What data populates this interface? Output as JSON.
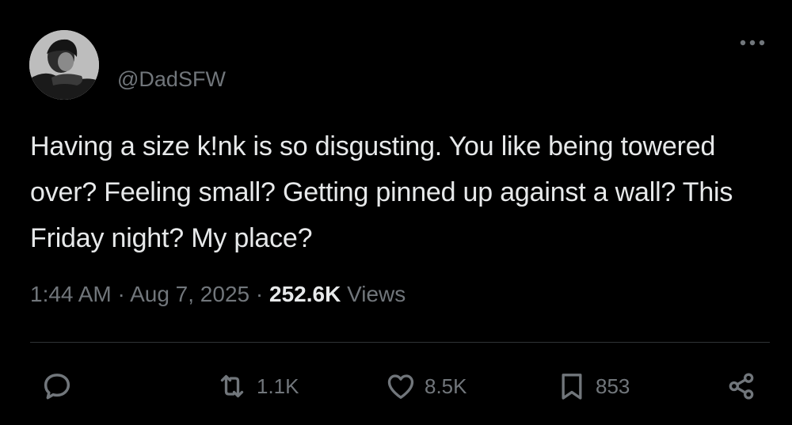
{
  "tweet": {
    "handle": "@DadSFW",
    "text": "Having a size k!nk is so disgusting. You like being towered over? Feeling small? Getting pinned up against a wall? This Friday night? My place?",
    "time": "1:44 AM",
    "separator": "·",
    "date": "Aug 7, 2025",
    "views_count": "252.6K",
    "views_label": "Views"
  },
  "actions": {
    "reply": {
      "icon": "reply-icon",
      "count": ""
    },
    "retweet": {
      "icon": "retweet-icon",
      "count": "1.1K"
    },
    "like": {
      "icon": "heart-icon",
      "count": "8.5K"
    },
    "bookmark": {
      "icon": "bookmark-icon",
      "count": "853"
    },
    "share": {
      "icon": "share-icon",
      "count": ""
    }
  },
  "colors": {
    "background": "#000000",
    "text_primary": "#e7e9ea",
    "text_secondary": "#71767b",
    "divider": "#2f3336"
  }
}
